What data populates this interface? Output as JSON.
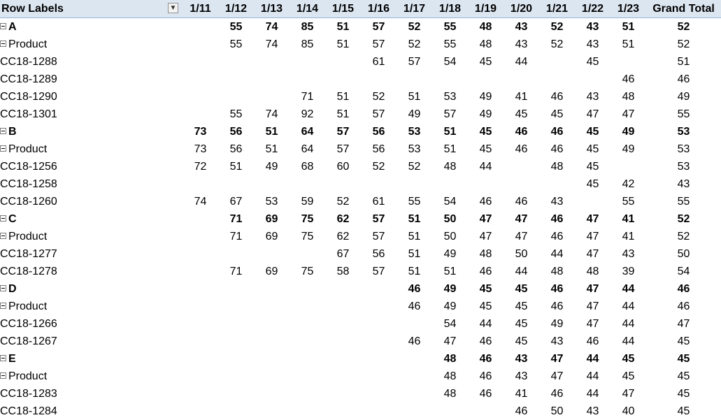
{
  "header": {
    "row_labels": "Row Labels",
    "filter_icon": "filter-dropdown-icon",
    "columns": [
      "1/11",
      "1/12",
      "1/13",
      "1/14",
      "1/15",
      "1/16",
      "1/17",
      "1/18",
      "1/19",
      "1/20",
      "1/21",
      "1/22",
      "1/23",
      "Grand Total"
    ]
  },
  "rows": [
    {
      "level": 0,
      "label": "A",
      "values": [
        "",
        "55",
        "74",
        "85",
        "51",
        "57",
        "52",
        "55",
        "48",
        "43",
        "52",
        "43",
        "51",
        "52"
      ]
    },
    {
      "level": 1,
      "label": "Product",
      "values": [
        "",
        "55",
        "74",
        "85",
        "51",
        "57",
        "52",
        "55",
        "48",
        "43",
        "52",
        "43",
        "51",
        "52"
      ]
    },
    {
      "level": 2,
      "label": "CC18-1288",
      "values": [
        "",
        "",
        "",
        "",
        "",
        "61",
        "57",
        "54",
        "45",
        "44",
        "",
        "45",
        "",
        "51"
      ]
    },
    {
      "level": 2,
      "label": "CC18-1289",
      "values": [
        "",
        "",
        "",
        "",
        "",
        "",
        "",
        "",
        "",
        "",
        "",
        "",
        "46",
        "46"
      ]
    },
    {
      "level": 2,
      "label": "CC18-1290",
      "values": [
        "",
        "",
        "",
        "71",
        "51",
        "52",
        "51",
        "53",
        "49",
        "41",
        "46",
        "43",
        "48",
        "49"
      ]
    },
    {
      "level": 2,
      "label": "CC18-1301",
      "values": [
        "",
        "55",
        "74",
        "92",
        "51",
        "57",
        "49",
        "57",
        "49",
        "45",
        "45",
        "47",
        "47",
        "55"
      ]
    },
    {
      "level": 0,
      "label": "B",
      "values": [
        "73",
        "56",
        "51",
        "64",
        "57",
        "56",
        "53",
        "51",
        "45",
        "46",
        "46",
        "45",
        "49",
        "53"
      ]
    },
    {
      "level": 1,
      "label": "Product",
      "values": [
        "73",
        "56",
        "51",
        "64",
        "57",
        "56",
        "53",
        "51",
        "45",
        "46",
        "46",
        "45",
        "49",
        "53"
      ]
    },
    {
      "level": 2,
      "label": "CC18-1256",
      "values": [
        "72",
        "51",
        "49",
        "68",
        "60",
        "52",
        "52",
        "48",
        "44",
        "",
        "48",
        "45",
        "",
        "53"
      ]
    },
    {
      "level": 2,
      "label": "CC18-1258",
      "values": [
        "",
        "",
        "",
        "",
        "",
        "",
        "",
        "",
        "",
        "",
        "",
        "45",
        "42",
        "43"
      ]
    },
    {
      "level": 2,
      "label": "CC18-1260",
      "values": [
        "74",
        "67",
        "53",
        "59",
        "52",
        "61",
        "55",
        "54",
        "46",
        "46",
        "43",
        "",
        "55",
        "55"
      ]
    },
    {
      "level": 0,
      "label": "C",
      "values": [
        "",
        "71",
        "69",
        "75",
        "62",
        "57",
        "51",
        "50",
        "47",
        "47",
        "46",
        "47",
        "41",
        "52"
      ]
    },
    {
      "level": 1,
      "label": "Product",
      "values": [
        "",
        "71",
        "69",
        "75",
        "62",
        "57",
        "51",
        "50",
        "47",
        "47",
        "46",
        "47",
        "41",
        "52"
      ]
    },
    {
      "level": 2,
      "label": "CC18-1277",
      "values": [
        "",
        "",
        "",
        "",
        "67",
        "56",
        "51",
        "49",
        "48",
        "50",
        "44",
        "47",
        "43",
        "50"
      ]
    },
    {
      "level": 2,
      "label": "CC18-1278",
      "values": [
        "",
        "71",
        "69",
        "75",
        "58",
        "57",
        "51",
        "51",
        "46",
        "44",
        "48",
        "48",
        "39",
        "54"
      ]
    },
    {
      "level": 0,
      "label": "D",
      "values": [
        "",
        "",
        "",
        "",
        "",
        "",
        "46",
        "49",
        "45",
        "45",
        "46",
        "47",
        "44",
        "46"
      ]
    },
    {
      "level": 1,
      "label": "Product",
      "values": [
        "",
        "",
        "",
        "",
        "",
        "",
        "46",
        "49",
        "45",
        "45",
        "46",
        "47",
        "44",
        "46"
      ]
    },
    {
      "level": 2,
      "label": "CC18-1266",
      "values": [
        "",
        "",
        "",
        "",
        "",
        "",
        "",
        "54",
        "44",
        "45",
        "49",
        "47",
        "44",
        "47"
      ]
    },
    {
      "level": 2,
      "label": "CC18-1267",
      "values": [
        "",
        "",
        "",
        "",
        "",
        "",
        "46",
        "47",
        "46",
        "45",
        "43",
        "46",
        "44",
        "45"
      ]
    },
    {
      "level": 0,
      "label": "E",
      "values": [
        "",
        "",
        "",
        "",
        "",
        "",
        "",
        "48",
        "46",
        "43",
        "47",
        "44",
        "45",
        "45"
      ]
    },
    {
      "level": 1,
      "label": "Product",
      "values": [
        "",
        "",
        "",
        "",
        "",
        "",
        "",
        "48",
        "46",
        "43",
        "47",
        "44",
        "45",
        "45"
      ]
    },
    {
      "level": 2,
      "label": "CC18-1283",
      "values": [
        "",
        "",
        "",
        "",
        "",
        "",
        "",
        "48",
        "46",
        "41",
        "46",
        "44",
        "47",
        "45"
      ]
    },
    {
      "level": 2,
      "label": "CC18-1284",
      "values": [
        "",
        "",
        "",
        "",
        "",
        "",
        "",
        "",
        "",
        "46",
        "50",
        "43",
        "40",
        "45"
      ]
    }
  ]
}
